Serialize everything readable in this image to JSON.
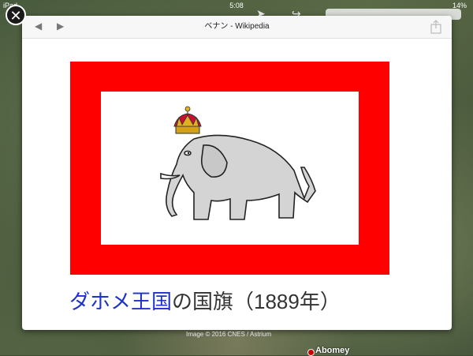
{
  "status_bar": {
    "carrier": "iPad",
    "time": "5:08",
    "battery": "14%"
  },
  "page": {
    "title": "ベナン - Wikipedia"
  },
  "caption": {
    "link_text": "ダホメ王国",
    "rest_text": "の国旗（1889年）"
  },
  "map": {
    "copyright": "Image © 2016 CNES / Astrium",
    "place_label": "Abomey"
  },
  "colors": {
    "flag_border": "#ff0000",
    "flag_field": "#ffffff",
    "elephant": "#d4d4d4",
    "crown": "#e0b020",
    "link": "#1d32c8"
  }
}
